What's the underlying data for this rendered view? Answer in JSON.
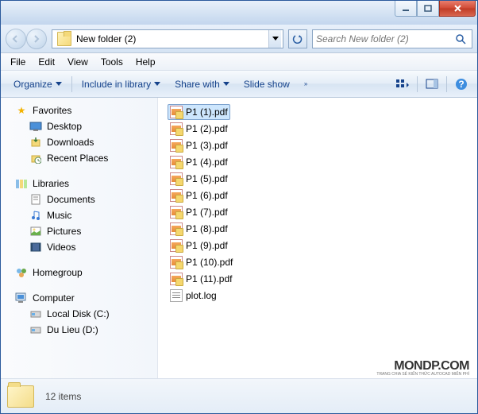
{
  "address": {
    "folder_name": "New folder (2)"
  },
  "search": {
    "placeholder": "Search New folder (2)"
  },
  "menubar": {
    "file": "File",
    "edit": "Edit",
    "view": "View",
    "tools": "Tools",
    "help": "Help"
  },
  "toolbar": {
    "organize": "Organize",
    "include": "Include in library",
    "share": "Share with",
    "slideshow": "Slide show"
  },
  "nav": {
    "favorites": {
      "label": "Favorites",
      "items": [
        "Desktop",
        "Downloads",
        "Recent Places"
      ]
    },
    "libraries": {
      "label": "Libraries",
      "items": [
        "Documents",
        "Music",
        "Pictures",
        "Videos"
      ]
    },
    "homegroup": {
      "label": "Homegroup"
    },
    "computer": {
      "label": "Computer",
      "items": [
        "Local Disk (C:)",
        "Du Lieu (D:)"
      ]
    }
  },
  "files": [
    {
      "name": "P1 (1).pdf",
      "type": "pdf",
      "selected": true
    },
    {
      "name": "P1 (2).pdf",
      "type": "pdf",
      "selected": false
    },
    {
      "name": "P1 (3).pdf",
      "type": "pdf",
      "selected": false
    },
    {
      "name": "P1 (4).pdf",
      "type": "pdf",
      "selected": false
    },
    {
      "name": "P1 (5).pdf",
      "type": "pdf",
      "selected": false
    },
    {
      "name": "P1 (6).pdf",
      "type": "pdf",
      "selected": false
    },
    {
      "name": "P1 (7).pdf",
      "type": "pdf",
      "selected": false
    },
    {
      "name": "P1 (8).pdf",
      "type": "pdf",
      "selected": false
    },
    {
      "name": "P1 (9).pdf",
      "type": "pdf",
      "selected": false
    },
    {
      "name": "P1 (10).pdf",
      "type": "pdf",
      "selected": false
    },
    {
      "name": "P1 (11).pdf",
      "type": "pdf",
      "selected": false
    },
    {
      "name": "plot.log",
      "type": "log",
      "selected": false
    }
  ],
  "status": {
    "count": "12 items"
  },
  "watermark": {
    "big": "MONDP.COM",
    "small": "TRANG CHIA SẺ KIẾN THỨC AUTOCAD MIỄN PHÍ"
  }
}
